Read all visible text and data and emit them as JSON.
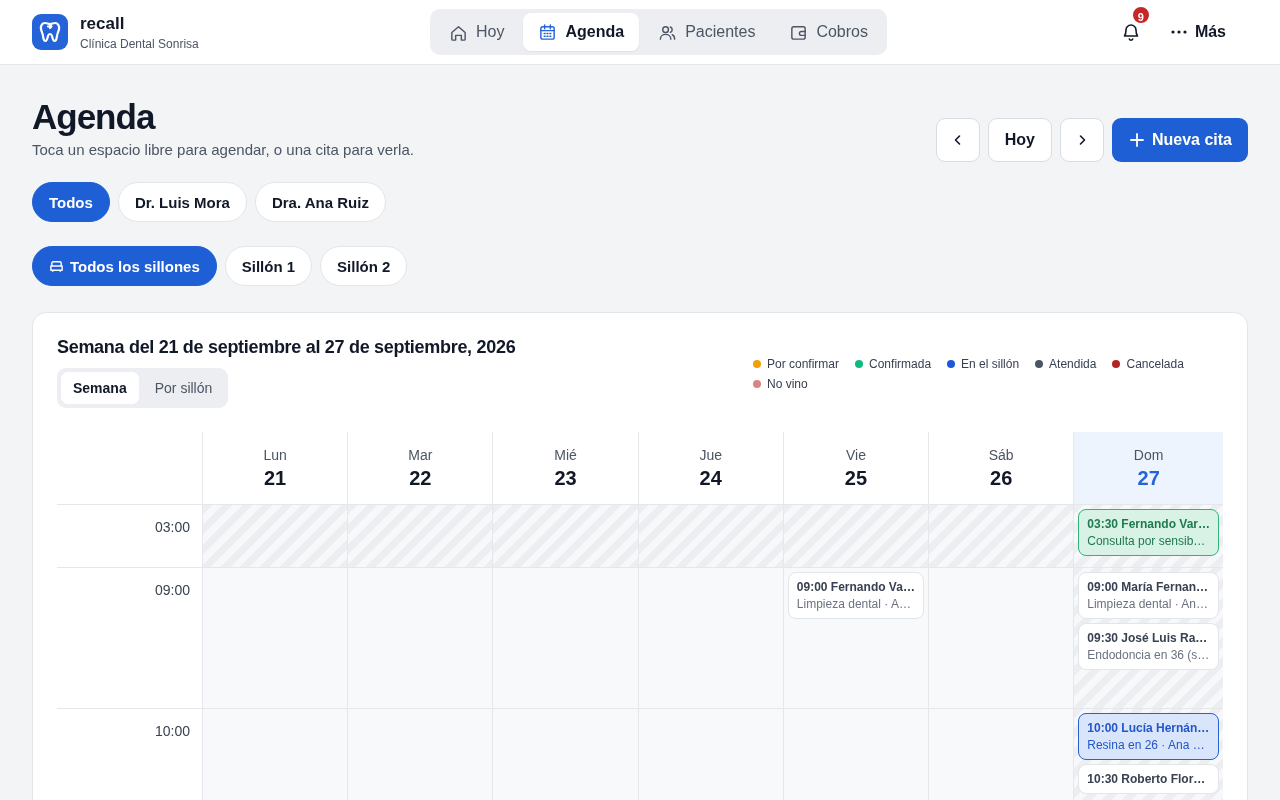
{
  "brand": {
    "name": "recall",
    "subtitle": "Clínica Dental Sonrisa"
  },
  "nav": [
    {
      "label": "Hoy",
      "selected": false
    },
    {
      "label": "Agenda",
      "selected": true
    },
    {
      "label": "Pacientes",
      "selected": false
    },
    {
      "label": "Cobros",
      "selected": false
    }
  ],
  "notifications": {
    "count": "9"
  },
  "more": {
    "label": "Más"
  },
  "page": {
    "title": "Agenda",
    "subtitle": "Toca un espacio libre para agendar, o una cita para verla."
  },
  "toolbar": {
    "today": "Hoy",
    "new": "Nueva cita"
  },
  "doctor_filters": [
    {
      "label": "Todos",
      "selected": true
    },
    {
      "label": "Dr. Luis Mora",
      "selected": false
    },
    {
      "label": "Dra. Ana Ruiz",
      "selected": false
    }
  ],
  "chair_filters": [
    {
      "label": "Todos los sillones",
      "selected": true,
      "icon": true
    },
    {
      "label": "Sillón 1",
      "selected": false,
      "icon": false
    },
    {
      "label": "Sillón 2",
      "selected": false,
      "icon": false
    }
  ],
  "calendar": {
    "title": "Semana del 21 de septiembre al 27 de septiembre, 2026",
    "views": [
      {
        "label": "Semana",
        "selected": true
      },
      {
        "label": "Por sillón",
        "selected": false
      }
    ],
    "legend": [
      {
        "label": "Por confirmar",
        "color": "#f59e0b"
      },
      {
        "label": "Confirmada",
        "color": "#10b981"
      },
      {
        "label": "En el sillón",
        "color": "#1d58d8"
      },
      {
        "label": "Atendida",
        "color": "#4b5563"
      },
      {
        "label": "Cancelada",
        "color": "#b42323"
      },
      {
        "label": "No vino",
        "color": "#d98585"
      }
    ],
    "days": [
      {
        "weekday": "Lun",
        "date": "21",
        "today": false
      },
      {
        "weekday": "Mar",
        "date": "22",
        "today": false
      },
      {
        "weekday": "Mié",
        "date": "23",
        "today": false
      },
      {
        "weekday": "Jue",
        "date": "24",
        "today": false
      },
      {
        "weekday": "Vie",
        "date": "25",
        "today": false
      },
      {
        "weekday": "Sáb",
        "date": "26",
        "today": false
      },
      {
        "weekday": "Dom",
        "date": "27",
        "today": true
      }
    ],
    "rows": [
      {
        "time": "03:00",
        "cells": [
          {
            "closed": true
          },
          {
            "closed": true
          },
          {
            "closed": true
          },
          {
            "closed": true
          },
          {
            "closed": true
          },
          {
            "closed": true
          },
          {
            "closed": true,
            "appointments": [
              {
                "title": "03:30 Fernando Var…",
                "detail": "Consulta por sensib…",
                "kind": "confirmed"
              }
            ]
          }
        ]
      },
      {
        "time": "09:00",
        "cells": [
          {
            "closed": false
          },
          {
            "closed": false
          },
          {
            "closed": false
          },
          {
            "closed": false
          },
          {
            "closed": false,
            "appointments": [
              {
                "title": "09:00 Fernando Va…",
                "detail": "Limpieza dental · A…",
                "kind": "plain"
              }
            ]
          },
          {
            "closed": false
          },
          {
            "closed": true,
            "appointments": [
              {
                "title": "09:00 María Fernan…",
                "detail": "Limpieza dental · An…",
                "kind": "plain"
              },
              {
                "title": "09:30 José Luis Ra…",
                "detail": "Endodoncia en 36 (s…",
                "kind": "plain"
              }
            ]
          }
        ]
      },
      {
        "time": "10:00",
        "cells": [
          {
            "closed": false
          },
          {
            "closed": false
          },
          {
            "closed": false
          },
          {
            "closed": false
          },
          {
            "closed": false
          },
          {
            "closed": false
          },
          {
            "closed": true,
            "appointments": [
              {
                "title": "10:00 Lucía Hernán…",
                "detail": "Resina en 26 · Ana …",
                "kind": "in-chair"
              },
              {
                "title": "10:30 Roberto Flor…",
                "kind": "plain"
              }
            ]
          }
        ]
      }
    ]
  }
}
